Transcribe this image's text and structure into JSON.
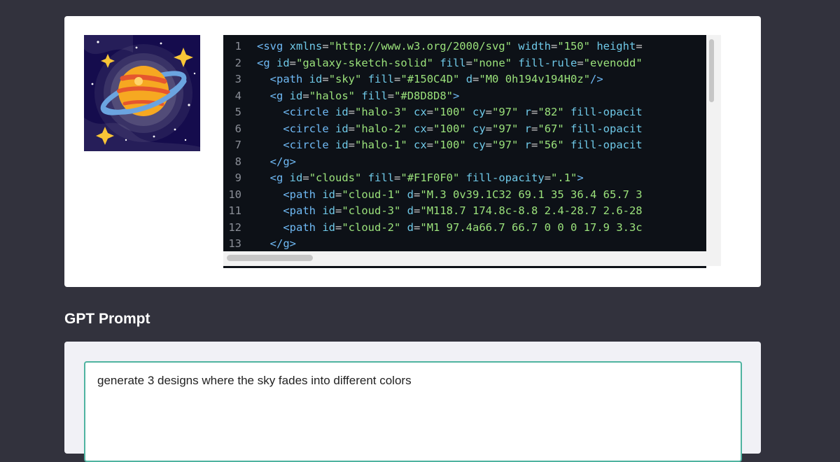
{
  "code_editor": {
    "lines": [
      {
        "num": "1",
        "indent": "",
        "tokens": [
          {
            "t": "tag",
            "v": "<svg"
          },
          {
            "t": "attr",
            "v": " xmlns"
          },
          {
            "t": "punct",
            "v": "="
          },
          {
            "t": "str",
            "v": "\"http://www.w3.org/2000/svg\""
          },
          {
            "t": "attr",
            "v": " width"
          },
          {
            "t": "punct",
            "v": "="
          },
          {
            "t": "str",
            "v": "\"150\""
          },
          {
            "t": "attr",
            "v": " height"
          },
          {
            "t": "punct",
            "v": "="
          }
        ]
      },
      {
        "num": "2",
        "indent": "",
        "tokens": [
          {
            "t": "tag",
            "v": "<g"
          },
          {
            "t": "attr",
            "v": " id"
          },
          {
            "t": "punct",
            "v": "="
          },
          {
            "t": "str",
            "v": "\"galaxy-sketch-solid\""
          },
          {
            "t": "attr",
            "v": " fill"
          },
          {
            "t": "punct",
            "v": "="
          },
          {
            "t": "str",
            "v": "\"none\""
          },
          {
            "t": "attr",
            "v": " fill-rule"
          },
          {
            "t": "punct",
            "v": "="
          },
          {
            "t": "str",
            "v": "\"evenodd\""
          }
        ]
      },
      {
        "num": "3",
        "indent": "  ",
        "tokens": [
          {
            "t": "tag",
            "v": "<path"
          },
          {
            "t": "attr",
            "v": " id"
          },
          {
            "t": "punct",
            "v": "="
          },
          {
            "t": "str",
            "v": "\"sky\""
          },
          {
            "t": "attr",
            "v": " fill"
          },
          {
            "t": "punct",
            "v": "="
          },
          {
            "t": "str",
            "v": "\"#150C4D\""
          },
          {
            "t": "attr",
            "v": " d"
          },
          {
            "t": "punct",
            "v": "="
          },
          {
            "t": "str",
            "v": "\"M0 0h194v194H0z\""
          },
          {
            "t": "tag",
            "v": "/>"
          }
        ]
      },
      {
        "num": "4",
        "indent": "  ",
        "tokens": [
          {
            "t": "tag",
            "v": "<g"
          },
          {
            "t": "attr",
            "v": " id"
          },
          {
            "t": "punct",
            "v": "="
          },
          {
            "t": "str",
            "v": "\"halos\""
          },
          {
            "t": "attr",
            "v": " fill"
          },
          {
            "t": "punct",
            "v": "="
          },
          {
            "t": "str",
            "v": "\"#D8D8D8\""
          },
          {
            "t": "tag",
            "v": ">"
          }
        ]
      },
      {
        "num": "5",
        "indent": "    ",
        "tokens": [
          {
            "t": "tag",
            "v": "<circle"
          },
          {
            "t": "attr",
            "v": " id"
          },
          {
            "t": "punct",
            "v": "="
          },
          {
            "t": "str",
            "v": "\"halo-3\""
          },
          {
            "t": "attr",
            "v": " cx"
          },
          {
            "t": "punct",
            "v": "="
          },
          {
            "t": "str",
            "v": "\"100\""
          },
          {
            "t": "attr",
            "v": " cy"
          },
          {
            "t": "punct",
            "v": "="
          },
          {
            "t": "str",
            "v": "\"97\""
          },
          {
            "t": "attr",
            "v": " r"
          },
          {
            "t": "punct",
            "v": "="
          },
          {
            "t": "str",
            "v": "\"82\""
          },
          {
            "t": "attr",
            "v": " fill-opacit"
          }
        ]
      },
      {
        "num": "6",
        "indent": "    ",
        "tokens": [
          {
            "t": "tag",
            "v": "<circle"
          },
          {
            "t": "attr",
            "v": " id"
          },
          {
            "t": "punct",
            "v": "="
          },
          {
            "t": "str",
            "v": "\"halo-2\""
          },
          {
            "t": "attr",
            "v": " cx"
          },
          {
            "t": "punct",
            "v": "="
          },
          {
            "t": "str",
            "v": "\"100\""
          },
          {
            "t": "attr",
            "v": " cy"
          },
          {
            "t": "punct",
            "v": "="
          },
          {
            "t": "str",
            "v": "\"97\""
          },
          {
            "t": "attr",
            "v": " r"
          },
          {
            "t": "punct",
            "v": "="
          },
          {
            "t": "str",
            "v": "\"67\""
          },
          {
            "t": "attr",
            "v": " fill-opacit"
          }
        ]
      },
      {
        "num": "7",
        "indent": "    ",
        "tokens": [
          {
            "t": "tag",
            "v": "<circle"
          },
          {
            "t": "attr",
            "v": " id"
          },
          {
            "t": "punct",
            "v": "="
          },
          {
            "t": "str",
            "v": "\"halo-1\""
          },
          {
            "t": "attr",
            "v": " cx"
          },
          {
            "t": "punct",
            "v": "="
          },
          {
            "t": "str",
            "v": "\"100\""
          },
          {
            "t": "attr",
            "v": " cy"
          },
          {
            "t": "punct",
            "v": "="
          },
          {
            "t": "str",
            "v": "\"97\""
          },
          {
            "t": "attr",
            "v": " r"
          },
          {
            "t": "punct",
            "v": "="
          },
          {
            "t": "str",
            "v": "\"56\""
          },
          {
            "t": "attr",
            "v": " fill-opacit"
          }
        ]
      },
      {
        "num": "8",
        "indent": "  ",
        "tokens": [
          {
            "t": "tag",
            "v": "</g>"
          }
        ]
      },
      {
        "num": "9",
        "indent": "  ",
        "tokens": [
          {
            "t": "tag",
            "v": "<g"
          },
          {
            "t": "attr",
            "v": " id"
          },
          {
            "t": "punct",
            "v": "="
          },
          {
            "t": "str",
            "v": "\"clouds\""
          },
          {
            "t": "attr",
            "v": " fill"
          },
          {
            "t": "punct",
            "v": "="
          },
          {
            "t": "str",
            "v": "\"#F1F0F0\""
          },
          {
            "t": "attr",
            "v": " fill-opacity"
          },
          {
            "t": "punct",
            "v": "="
          },
          {
            "t": "str",
            "v": "\".1\""
          },
          {
            "t": "tag",
            "v": ">"
          }
        ]
      },
      {
        "num": "10",
        "indent": "    ",
        "tokens": [
          {
            "t": "tag",
            "v": "<path"
          },
          {
            "t": "attr",
            "v": " id"
          },
          {
            "t": "punct",
            "v": "="
          },
          {
            "t": "str",
            "v": "\"cloud-1\""
          },
          {
            "t": "attr",
            "v": " d"
          },
          {
            "t": "punct",
            "v": "="
          },
          {
            "t": "str",
            "v": "\"M.3 0v39.1C32 69.1 35 36.4 65.7 3"
          }
        ]
      },
      {
        "num": "11",
        "indent": "    ",
        "tokens": [
          {
            "t": "tag",
            "v": "<path"
          },
          {
            "t": "attr",
            "v": " id"
          },
          {
            "t": "punct",
            "v": "="
          },
          {
            "t": "str",
            "v": "\"cloud-3\""
          },
          {
            "t": "attr",
            "v": " d"
          },
          {
            "t": "punct",
            "v": "="
          },
          {
            "t": "str",
            "v": "\"M118.7 174.8c-8.8 2.4-28.7 2.6-28"
          }
        ]
      },
      {
        "num": "12",
        "indent": "    ",
        "tokens": [
          {
            "t": "tag",
            "v": "<path"
          },
          {
            "t": "attr",
            "v": " id"
          },
          {
            "t": "punct",
            "v": "="
          },
          {
            "t": "str",
            "v": "\"cloud-2\""
          },
          {
            "t": "attr",
            "v": " d"
          },
          {
            "t": "punct",
            "v": "="
          },
          {
            "t": "str",
            "v": "\"M1 97.4a66.7 66.7 0 0 0 17.9 3.3c"
          }
        ]
      },
      {
        "num": "13",
        "indent": "  ",
        "tokens": [
          {
            "t": "tag",
            "v": "</g>"
          }
        ]
      }
    ]
  },
  "prompt_section": {
    "title": "GPT Prompt",
    "input_value": "generate 3 designs where the sky fades into different colors"
  },
  "colors": {
    "page_bg": "#32323d",
    "sky": "#150C4D",
    "planet": "#F6A821",
    "ring": "#6BA4E0",
    "star": "#F8C537",
    "prompt_border": "#4fb3a0"
  },
  "icons": {
    "thumbnail": "galaxy-planet-illustration"
  }
}
